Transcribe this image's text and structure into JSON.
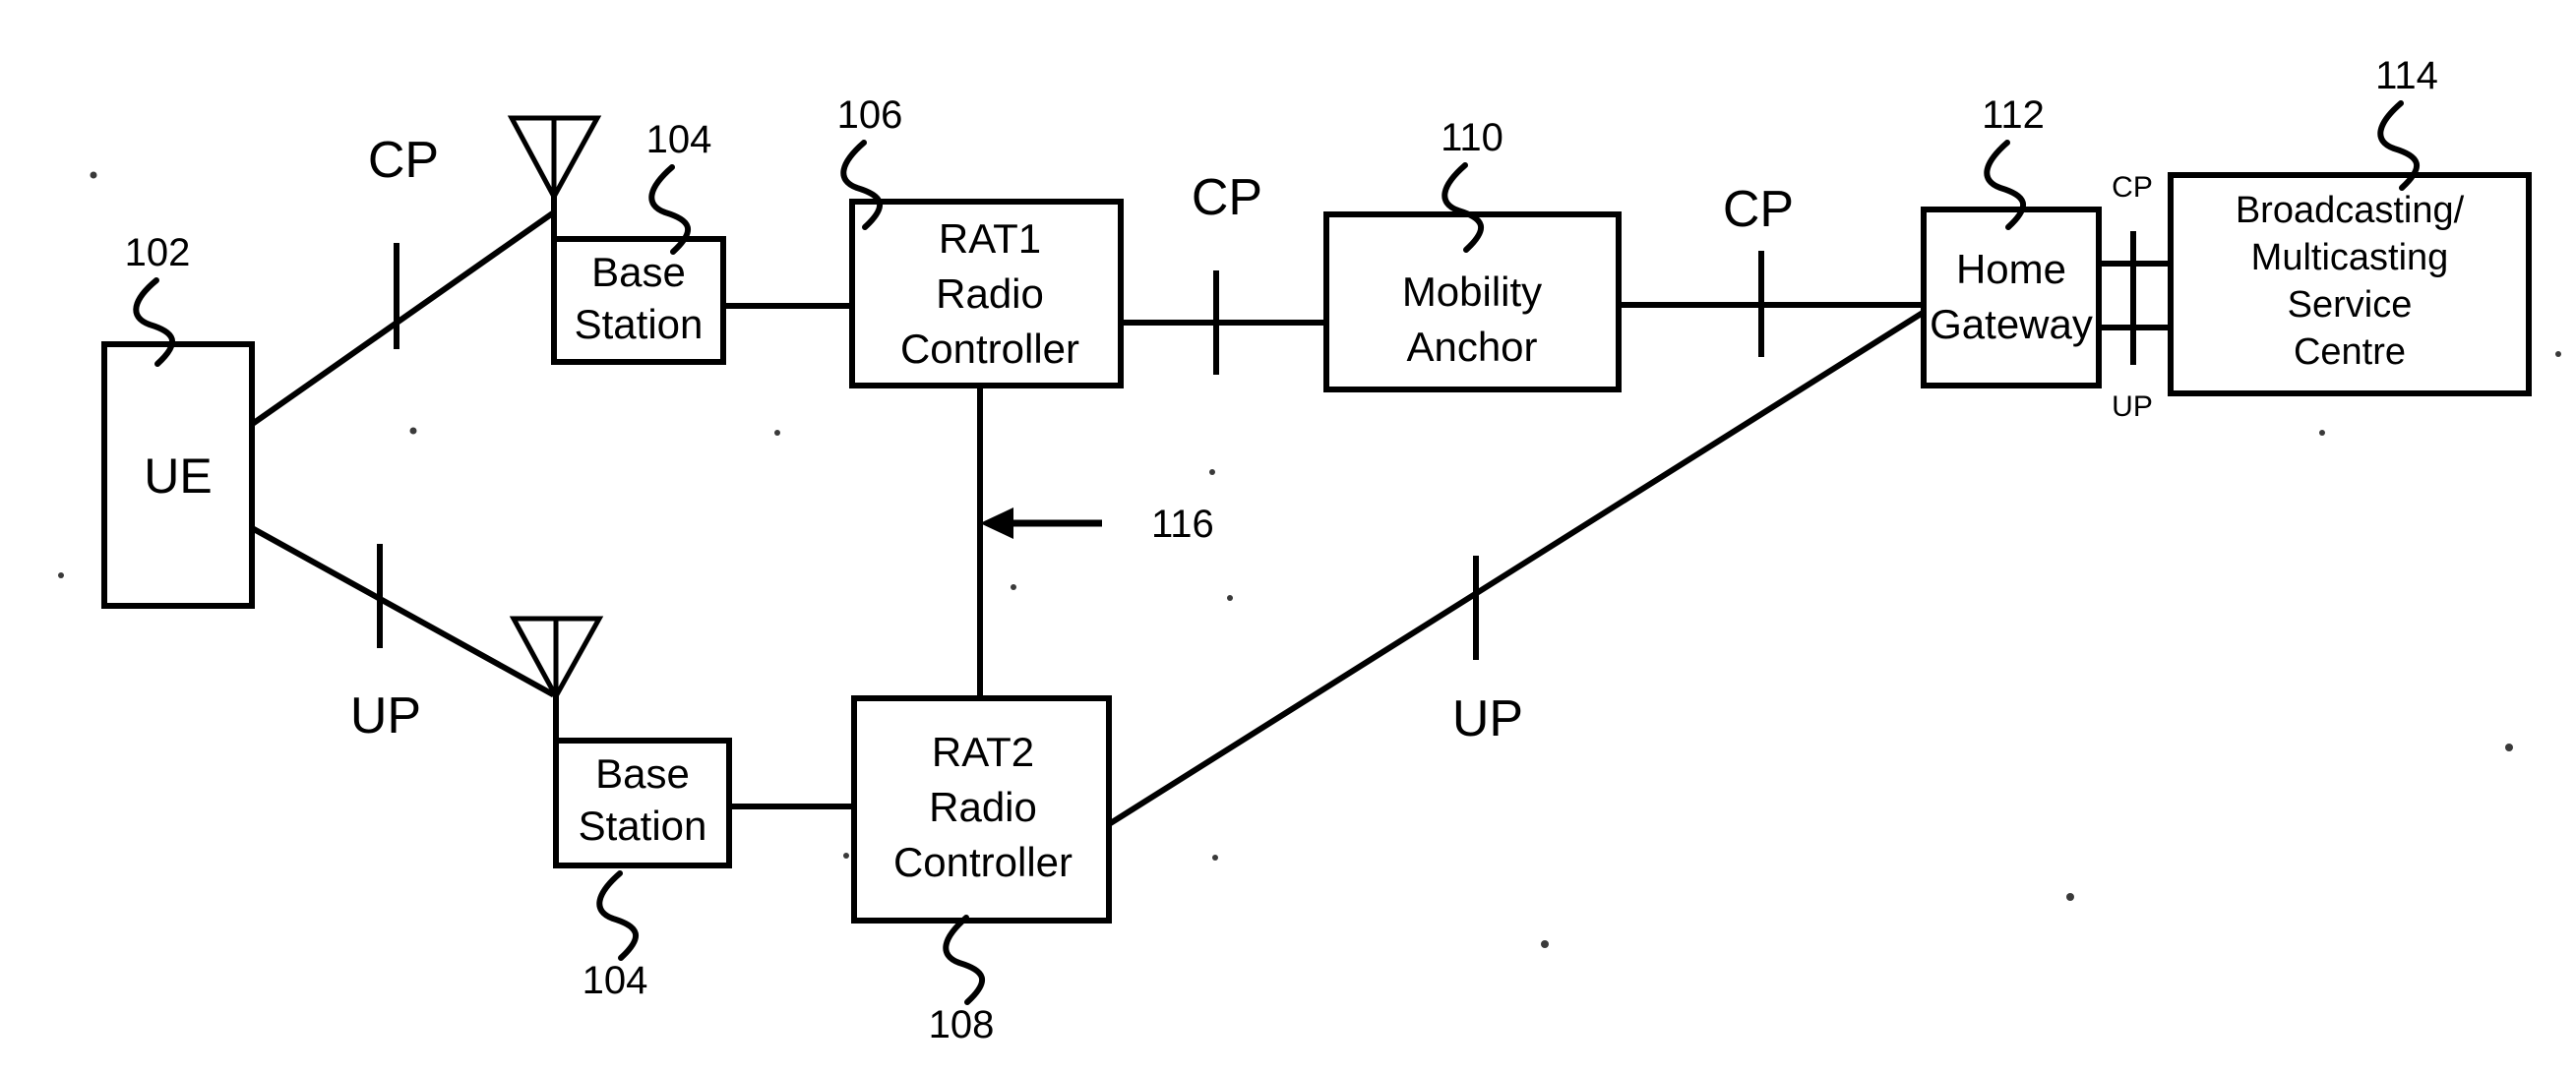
{
  "figure": {
    "type": "patent-network-diagram",
    "background_color": "#ffffff",
    "stroke_color": "#000000"
  },
  "nodes": {
    "ue": {
      "label": "UE",
      "ref": "102"
    },
    "base_station_top": {
      "label_line1": "Base",
      "label_line2": "Station",
      "ref": "104"
    },
    "base_station_bottom": {
      "label_line1": "Base",
      "label_line2": "Station",
      "ref": "104"
    },
    "rat1": {
      "label_line1": "RAT1",
      "label_line2": "Radio",
      "label_line3": "Controller",
      "ref": "106"
    },
    "rat2": {
      "label_line1": "RAT2",
      "label_line2": "Radio",
      "label_line3": "Controller",
      "ref": "108"
    },
    "mobility_anchor": {
      "label_line1": "Mobility",
      "label_line2": "Anchor",
      "ref": "110"
    },
    "home_gateway": {
      "label_line1": "Home",
      "label_line2": "Gateway",
      "ref": "112"
    },
    "bmsc": {
      "label_line1": "Broadcasting/",
      "label_line2": "Multicasting",
      "label_line3": "Service",
      "label_line4": "Centre",
      "ref": "114"
    }
  },
  "link_labels": {
    "ue_to_bs_top": "CP",
    "ue_to_bs_bottom": "UP",
    "rat1_to_mobility": "CP",
    "mobility_to_gateway": "CP",
    "rat2_to_gateway": "UP",
    "gateway_to_bmsc_cp": "CP",
    "gateway_to_bmsc_up": "UP"
  },
  "annotations": {
    "interface_116": "116"
  }
}
